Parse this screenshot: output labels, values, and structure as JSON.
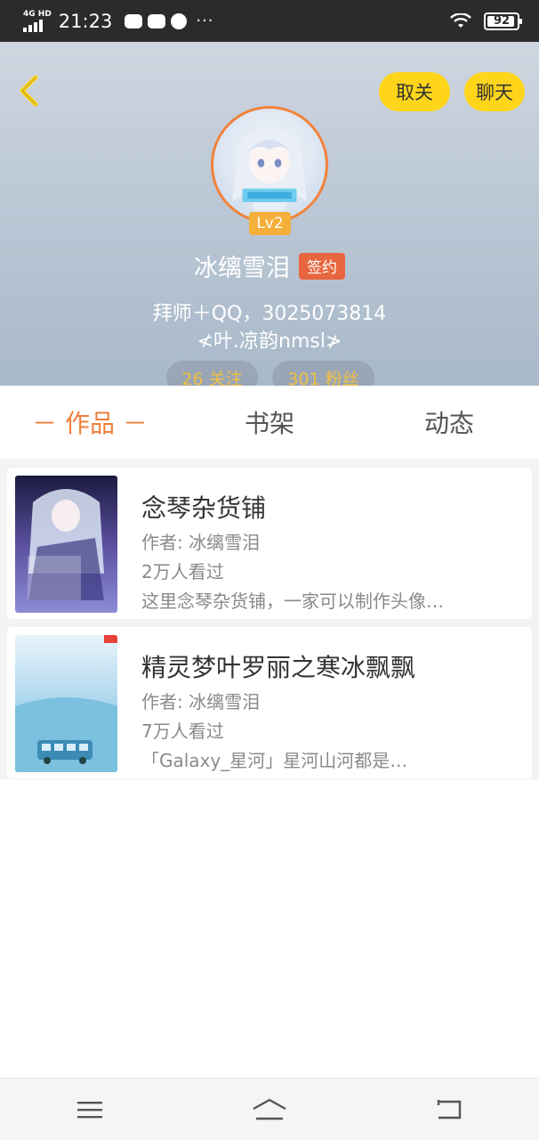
{
  "status_bar": {
    "network": "4G HD",
    "time": "21:23",
    "more": "···",
    "battery": "92"
  },
  "header": {
    "unfollow_label": "取关",
    "chat_label": "聊天",
    "level": "Lv2",
    "username": "冰缡雪泪",
    "signed_badge": "签约",
    "bio_line1": "拜师＋QQ，3025073814",
    "bio_line2": "≮叶.凉韵nmsl≯",
    "following": "26 关注",
    "followers": "301 粉丝",
    "accent_color": "#ffd51a",
    "badge_color": "#e8663f"
  },
  "tabs": [
    {
      "label": "－ 作品 －",
      "active": true
    },
    {
      "label": "书架",
      "active": false
    },
    {
      "label": "动态",
      "active": false
    }
  ],
  "works": [
    {
      "title": "念琴杂货铺",
      "author": "作者: 冰缡雪泪",
      "views": "2万人看过",
      "description": "这里念琴杂货铺，一家可以制作头像…"
    },
    {
      "title": "精灵梦叶罗丽之寒冰飘飘",
      "author": "作者: 冰缡雪泪",
      "views": "7万人看过",
      "description": "「Galaxy_星河」星河山河都是…"
    }
  ],
  "nav_bar": {
    "icons": [
      "menu-icon",
      "home-icon",
      "back-icon"
    ]
  }
}
